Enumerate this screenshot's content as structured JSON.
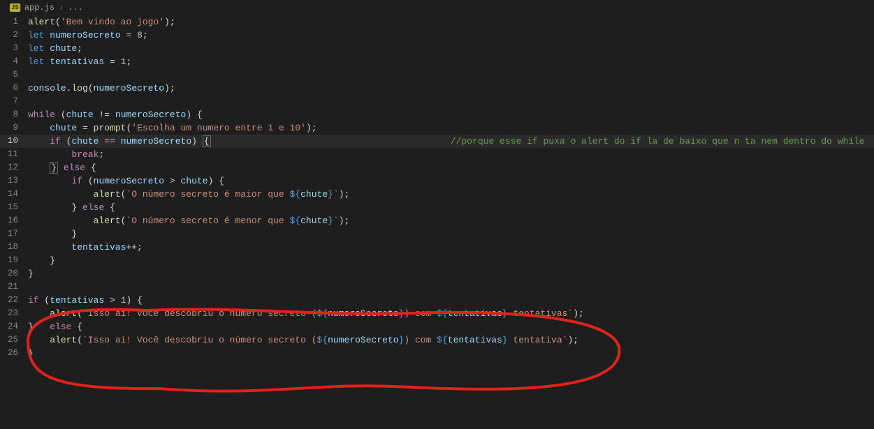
{
  "breadcrumb": {
    "icon": "JS",
    "file": "app.js",
    "tail": "..."
  },
  "activeLine": 10,
  "lines": [
    {
      "n": 1,
      "html": "<span class='fn'>alert</span><span class='pun'>(</span><span class='str'>'Bem vindo ao jogo'</span><span class='pun'>);</span>"
    },
    {
      "n": 2,
      "html": "<span class='kw'>let</span> <span class='id'>numeroSecreto</span> <span class='pun'>=</span> <span class='num'>8</span><span class='pun'>;</span>"
    },
    {
      "n": 3,
      "html": "<span class='kw'>let</span> <span class='id'>chute</span><span class='pun'>;</span>"
    },
    {
      "n": 4,
      "html": "<span class='kw'>let</span> <span class='id'>tentativas</span> <span class='pun'>=</span> <span class='num'>1</span><span class='pun'>;</span>"
    },
    {
      "n": 5,
      "html": ""
    },
    {
      "n": 6,
      "html": "<span class='id'>console</span><span class='pun'>.</span><span class='fn'>log</span><span class='pun'>(</span><span class='id'>numeroSecreto</span><span class='pun'>);</span>"
    },
    {
      "n": 7,
      "html": ""
    },
    {
      "n": 8,
      "html": "<span class='ctrl'>while</span> <span class='pun'>(</span><span class='id'>chute</span> <span class='pun'>!=</span> <span class='id'>numeroSecreto</span><span class='pun'>) {</span>"
    },
    {
      "n": 9,
      "html": "    <span class='id'>chute</span> <span class='pun'>=</span> <span class='fn'>prompt</span><span class='pun'>(</span><span class='str'>'Escolha um numero entre 1 e 10'</span><span class='pun'>);</span>"
    },
    {
      "n": 10,
      "html": "    <span class='ctrl'>if</span> <span class='pun'>(</span><span class='id'>chute</span> <span class='pun'>==</span> <span class='id'>numeroSecreto</span><span class='pun'>)</span> <span class='brbox pun'>{</span>                                            <span class='cmt'>//porque esse if puxa o alert do if la de baixo que n ta nem dentro do while</span>"
    },
    {
      "n": 11,
      "html": "        <span class='ctrl'>break</span><span class='pun'>;</span>"
    },
    {
      "n": 12,
      "html": "    <span class='brbox pun'>}</span> <span class='ctrl'>else</span> <span class='pun'>{</span>"
    },
    {
      "n": 13,
      "html": "        <span class='ctrl'>if</span> <span class='pun'>(</span><span class='id'>numeroSecreto</span> <span class='pun'>&gt;</span> <span class='id'>chute</span><span class='pun'>) {</span>"
    },
    {
      "n": 14,
      "html": "            <span class='fn'>alert</span><span class='pun'>(</span><span class='str'>`O número secreto é maior que </span><span class='tpl'>${</span><span class='id'>chute</span><span class='tpl'>}</span><span class='str'>`</span><span class='pun'>);</span>"
    },
    {
      "n": 15,
      "html": "        <span class='pun'>}</span> <span class='ctrl'>else</span> <span class='pun'>{</span>"
    },
    {
      "n": 16,
      "html": "            <span class='fn'>alert</span><span class='pun'>(</span><span class='str'>`O número secreto é menor que </span><span class='tpl'>${</span><span class='id'>chute</span><span class='tpl'>}</span><span class='str'>`</span><span class='pun'>);</span>"
    },
    {
      "n": 17,
      "html": "        <span class='pun'>}</span>"
    },
    {
      "n": 18,
      "html": "        <span class='id'>tentativas</span><span class='pun'>++;</span>"
    },
    {
      "n": 19,
      "html": "    <span class='pun'>}</span>"
    },
    {
      "n": 20,
      "html": "<span class='pun'>}</span>"
    },
    {
      "n": 21,
      "html": ""
    },
    {
      "n": 22,
      "html": "<span class='ctrl'>if</span> <span class='pun'>(</span><span class='id'>tentativas</span> <span class='pun'>&gt;</span> <span class='num'>1</span><span class='pun'>) {</span>"
    },
    {
      "n": 23,
      "html": "    <span class='fn'>alert</span><span class='pun'>(</span><span class='str'>`Isso ai! Você descobriu o número secreto (</span><span class='tpl'>${</span><span class='id'>numeroSecreto</span><span class='tpl'>}</span><span class='str'>) com </span><span class='tpl'>${</span><span class='id'>tentativas</span><span class='tpl'>}</span><span class='str'> tentativas`</span><span class='pun'>);</span>"
    },
    {
      "n": 24,
      "html": "<span class='pun'>}</span>   <span class='ctrl'>else</span> <span class='pun'>{</span>"
    },
    {
      "n": 25,
      "html": "    <span class='fn'>alert</span><span class='pun'>(</span><span class='str'>`Isso ai! Você descobriu o número secreto (</span><span class='tpl'>${</span><span class='id'>numeroSecreto</span><span class='tpl'>}</span><span class='str'>) com </span><span class='tpl'>${</span><span class='id'>tentativas</span><span class='tpl'>}</span><span class='str'> tentativa`</span><span class='pun'>);</span>"
    },
    {
      "n": 26,
      "html": "<span class='pun'>}</span>"
    }
  ]
}
